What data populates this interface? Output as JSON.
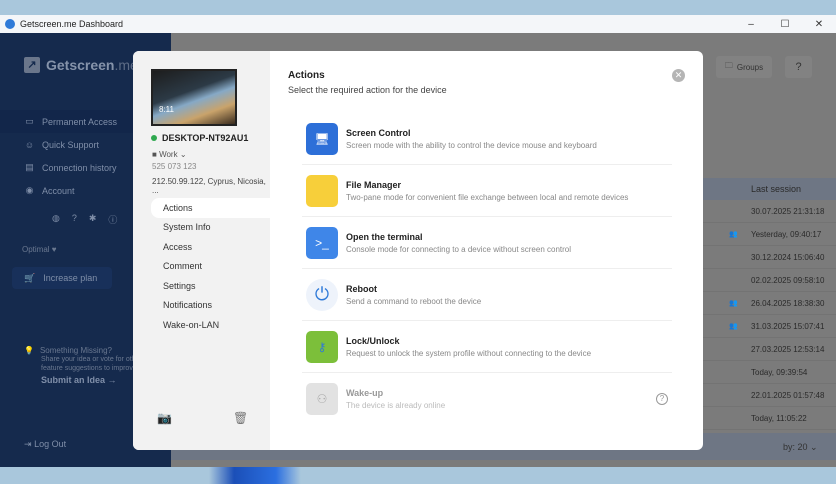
{
  "window": {
    "title": "Getscreen.me Dashboard",
    "controls": [
      "–",
      "☐",
      "✕"
    ]
  },
  "sidebar": {
    "brand": "Getscreen",
    "brand_tld": ".me",
    "items": [
      {
        "label": "Permanent Access",
        "icon": "devices-icon"
      },
      {
        "label": "Quick Support",
        "icon": "support-icon"
      },
      {
        "label": "Connection history",
        "icon": "history-icon"
      },
      {
        "label": "Account",
        "icon": "account-icon"
      }
    ],
    "plan": "Optimal",
    "increase_plan": "Increase plan",
    "idea": {
      "title": "Something Missing?",
      "desc": "Share your idea or vote for other feature suggestions to improve system.",
      "link": "Submit an Idea →"
    },
    "logout": "Log Out"
  },
  "main": {
    "groups_label": "Groups",
    "table": {
      "last_session_header": "Last session",
      "rows": [
        {
          "last_session": "30.07.2025 21:31:18",
          "icon": false
        },
        {
          "last_session": "Yesterday, 09:40:17",
          "icon": true
        },
        {
          "last_session": "30.12.2024 15:06:40",
          "icon": false
        },
        {
          "last_session": "02.02.2025 09:58:10",
          "icon": false
        },
        {
          "last_session": "26.04.2025 18:38:30",
          "icon": true
        },
        {
          "last_session": "31.03.2025 15:07:41",
          "icon": true
        },
        {
          "last_session": "27.03.2025 12:53:14",
          "icon": false
        },
        {
          "last_session": "Today, 09:39:54",
          "icon": false
        },
        {
          "last_session": "22.01.2025 01:57:48",
          "icon": false
        },
        {
          "last_session": "Today, 11:05:22",
          "icon": false
        }
      ],
      "per_page": "by:  20 ⌄"
    }
  },
  "modal": {
    "device": {
      "thumb_time": "8:11",
      "name": "DESKTOP-NT92AU1",
      "status_color": "#2fa84f",
      "group": "Work ⌄",
      "id": "525 073 123",
      "location": "212.50.99.122, Cyprus, Nicosia, ..."
    },
    "nav": [
      "Actions",
      "System Info",
      "Access",
      "Comment",
      "Settings",
      "Notifications",
      "Wake-on-LAN"
    ],
    "title": "Actions",
    "subtitle": "Select the required action for the device",
    "actions": [
      {
        "title": "Screen Control",
        "desc": "Screen mode with the ability to control the device mouse and keyboard",
        "icon": "laptop-icon"
      },
      {
        "title": "File Manager",
        "desc": "Two-pane mode for convenient file exchange between local and remote devices",
        "icon": "folder-icon"
      },
      {
        "title": "Open the terminal",
        "desc": "Console mode for connecting to a device without screen control",
        "icon": "terminal-icon"
      },
      {
        "title": "Reboot",
        "desc": "Send a command to reboot the device",
        "icon": "power-icon"
      },
      {
        "title": "Lock/Unlock",
        "desc": "Request to unlock the system profile without connecting to the device",
        "icon": "key-shield-icon"
      },
      {
        "title": "Wake-up",
        "desc": "The device is already online",
        "icon": "socket-icon",
        "disabled": true
      }
    ]
  }
}
